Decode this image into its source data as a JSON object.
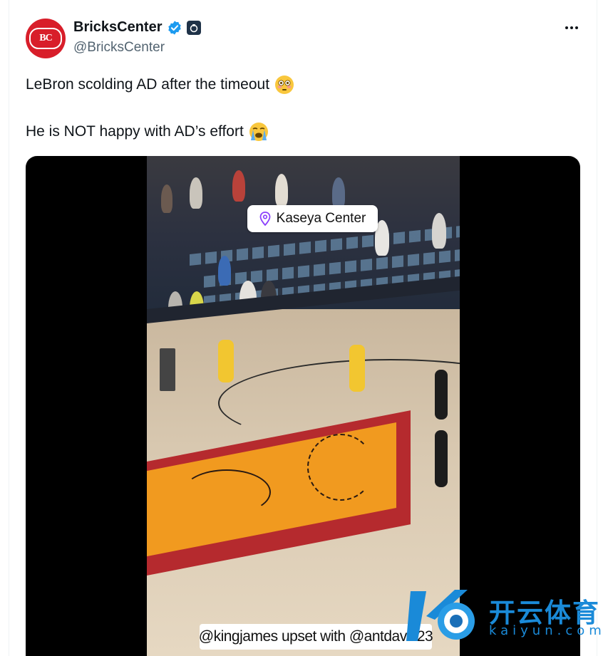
{
  "post": {
    "display_name": "BricksCenter",
    "handle": "@BricksCenter",
    "avatar_text": "BC",
    "line1": "LeBron scolding AD after the timeout",
    "line2": "He is NOT happy with AD’s effort"
  },
  "video": {
    "location": "Kaseya Center",
    "caption": "@kingjames upset with @antdavis23"
  },
  "watermark": {
    "chinese": "开云体育",
    "latin": "kaiyun.com"
  },
  "colors": {
    "verified": "#1d9bf0",
    "avatar": "#d81e2a",
    "watermark": "#1a8ad8"
  },
  "icons": [
    "verified-badge-icon",
    "affiliate-badge-icon",
    "more-options-icon",
    "flushed-face-emoji",
    "crying-face-emoji",
    "location-pin-icon"
  ]
}
